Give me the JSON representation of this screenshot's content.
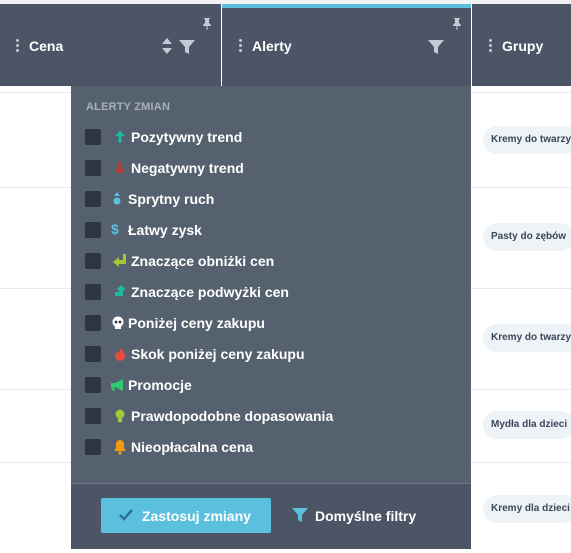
{
  "columns": [
    {
      "label": "Cena"
    },
    {
      "label": "Alerty"
    },
    {
      "label": "Grupy"
    }
  ],
  "rows": [
    {
      "group": "Kremy do twarzy"
    },
    {
      "group": "Pasty do zębów"
    },
    {
      "group": "Kremy do twarzy"
    },
    {
      "group": "Mydła dla dzieci"
    },
    {
      "group": "Kremy dla dzieci"
    }
  ],
  "alerts_panel": {
    "heading": "ALERTY ZMIAN",
    "options": [
      {
        "label": "Pozytywny trend",
        "icon": "arrow-up-icon",
        "color": "#1abc9c",
        "checked": false
      },
      {
        "label": "Negatywny trend",
        "icon": "arrow-down-icon",
        "color": "#c0392b",
        "checked": false
      },
      {
        "label": "Sprytny ruch",
        "icon": "up-down-icon",
        "color": "#5bc0de",
        "checked": false
      },
      {
        "label": "Łatwy zysk",
        "icon": "dollar-icon",
        "color": "#5bc0de",
        "checked": false
      },
      {
        "label": "Znaczące obniżki cen",
        "icon": "turn-down-arrow-icon",
        "color": "#a4c639",
        "checked": false
      },
      {
        "label": "Znaczące podwyżki cen",
        "icon": "turn-up-arrow-icon",
        "color": "#1abc9c",
        "checked": false
      },
      {
        "label": "Poniżej ceny zakupu",
        "icon": "skull-icon",
        "color": "#ffffff",
        "checked": false
      },
      {
        "label": "Skok poniżej ceny zakupu",
        "icon": "fire-icon",
        "color": "#e74c3c",
        "checked": false
      },
      {
        "label": "Promocje",
        "icon": "megaphone-icon",
        "color": "#2ecc71",
        "checked": false
      },
      {
        "label": "Prawdopodobne dopasowania",
        "icon": "lightbulb-icon",
        "color": "#a4c639",
        "checked": false
      },
      {
        "label": "Nieopłacalna cena",
        "icon": "bell-icon",
        "color": "#f39c12",
        "checked": false
      }
    ],
    "apply_label": "Zastosuj zmiany",
    "default_filters_label": "Domyślne filtry"
  },
  "colors": {
    "header_bg": "#4b5566",
    "panel_bg": "#56616f",
    "accent": "#5bc0de"
  }
}
